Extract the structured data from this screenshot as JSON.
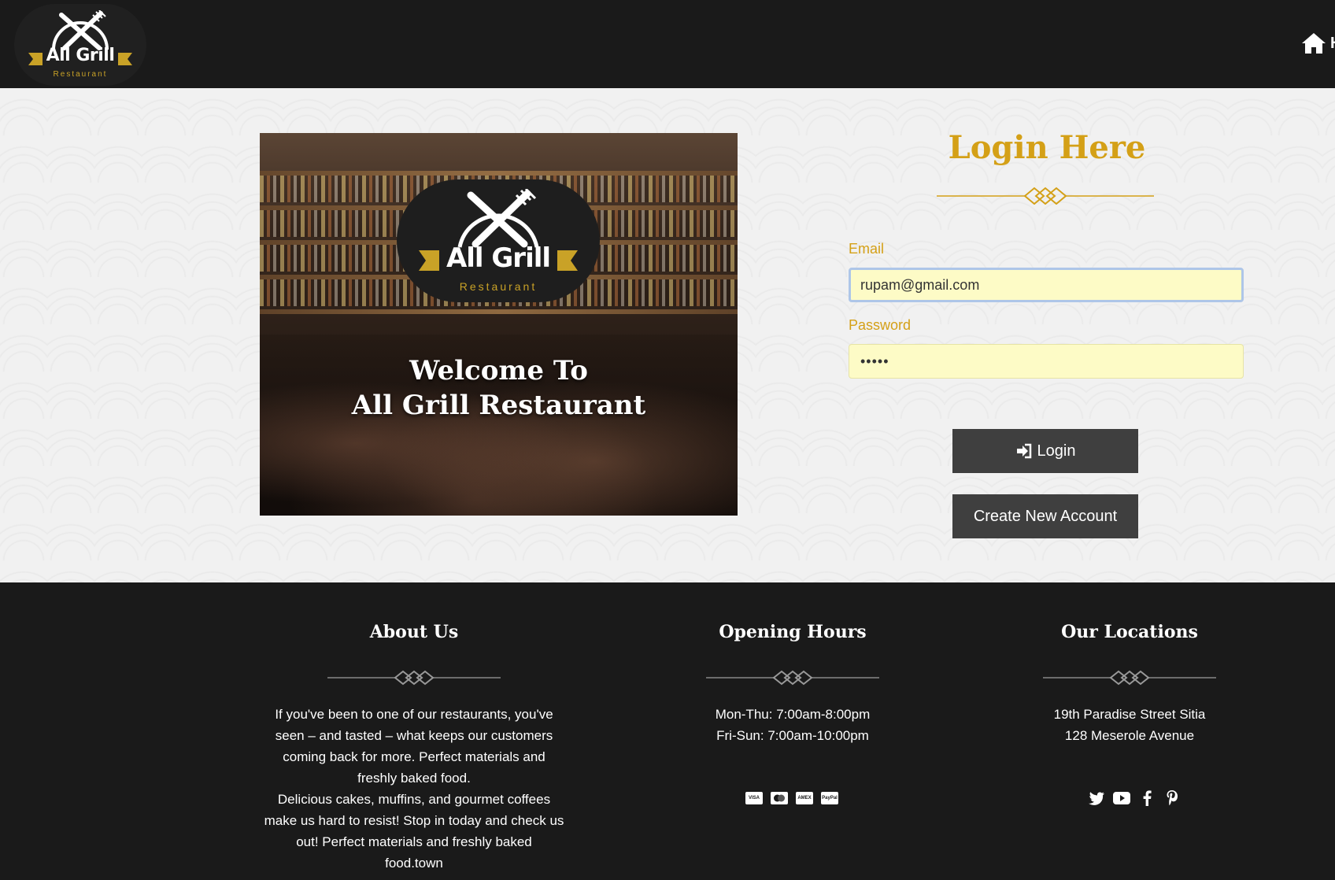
{
  "header": {
    "logo": {
      "brand": "All Grill",
      "sub": "Restaurant"
    },
    "home_icon": "home-icon",
    "home_label": "H"
  },
  "hero": {
    "logo": {
      "brand": "All Grill",
      "sub": "Restaurant"
    },
    "welcome_line1": "Welcome To",
    "welcome_line2": "All Grill Restaurant"
  },
  "login": {
    "title": "Login Here",
    "email_label": "Email",
    "email_value": "rupam@gmail.com",
    "password_label": "Password",
    "password_value": "•••••",
    "login_button": "Login",
    "login_icon": "sign-in-icon",
    "create_button": "Create New Account"
  },
  "footer": {
    "about": {
      "title": "About Us",
      "lines": [
        "If you've been to one of our restaurants, you've",
        "seen – and tasted – what keeps our customers",
        "coming back for more. Perfect materials and",
        "freshly baked food.",
        "Delicious cakes, muffins, and gourmet coffees",
        "make us hard to resist! Stop in today and check us",
        "out! Perfect materials and freshly baked",
        "food.town"
      ]
    },
    "hours": {
      "title": "Opening Hours",
      "lines": [
        "Mon-Thu: 7:00am-8:00pm",
        "Fri-Sun: 7:00am-10:00pm"
      ],
      "payment_icons": [
        "visa-icon",
        "mastercard-icon",
        "amex-icon",
        "paypal-icon"
      ],
      "card_labels": [
        "VISA",
        "MC",
        "AMEX",
        "PayPal"
      ]
    },
    "locations": {
      "title": "Our Locations",
      "lines": [
        "19th Paradise Street Sitia",
        "128 Meserole Avenue"
      ],
      "social_icons": [
        "twitter-icon",
        "youtube-icon",
        "facebook-icon",
        "pinterest-icon"
      ]
    }
  },
  "colors": {
    "dark": "#1a1a1a",
    "gold": "#d4a017",
    "button": "#3f3f3f",
    "input_bg": "#fdfbc6"
  }
}
